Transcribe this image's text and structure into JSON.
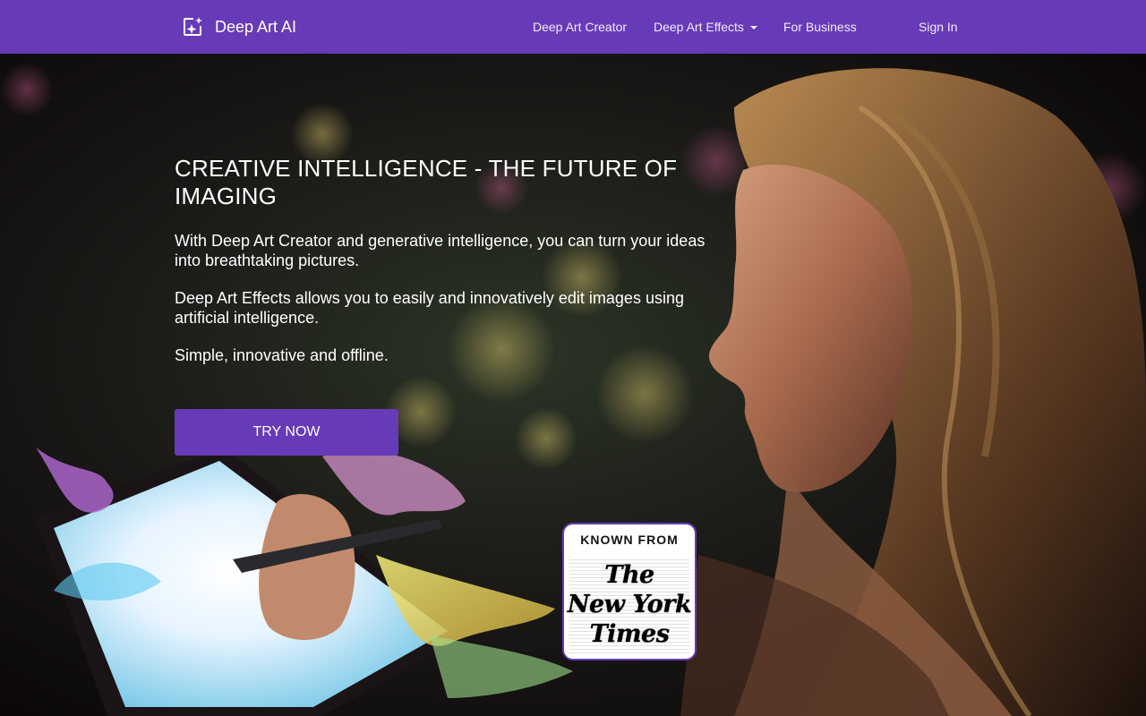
{
  "header": {
    "brand_name": "Deep Art AI",
    "brand_icon": "sparkle-image-icon",
    "nav": {
      "creator": "Deep Art Creator",
      "effects": "Deep Art Effects",
      "business": "For Business",
      "signin": "Sign In"
    }
  },
  "hero": {
    "headline": "CREATIVE INTELLIGENCE - THE FUTURE OF IMAGING",
    "paragraph_1": "With Deep Art Creator and generative intelligence, you can turn your ideas into breathtaking pictures.",
    "paragraph_2": "Deep Art Effects allows you to easily and innovatively edit images using artificial intelligence.",
    "paragraph_3": "Simple, innovative and offline.",
    "cta_label": "TRY NOW"
  },
  "badge": {
    "label": "KNOWN FROM",
    "publication": "The New York Times"
  },
  "colors": {
    "brand_purple": "#673ab7",
    "text_white": "#ffffff"
  }
}
